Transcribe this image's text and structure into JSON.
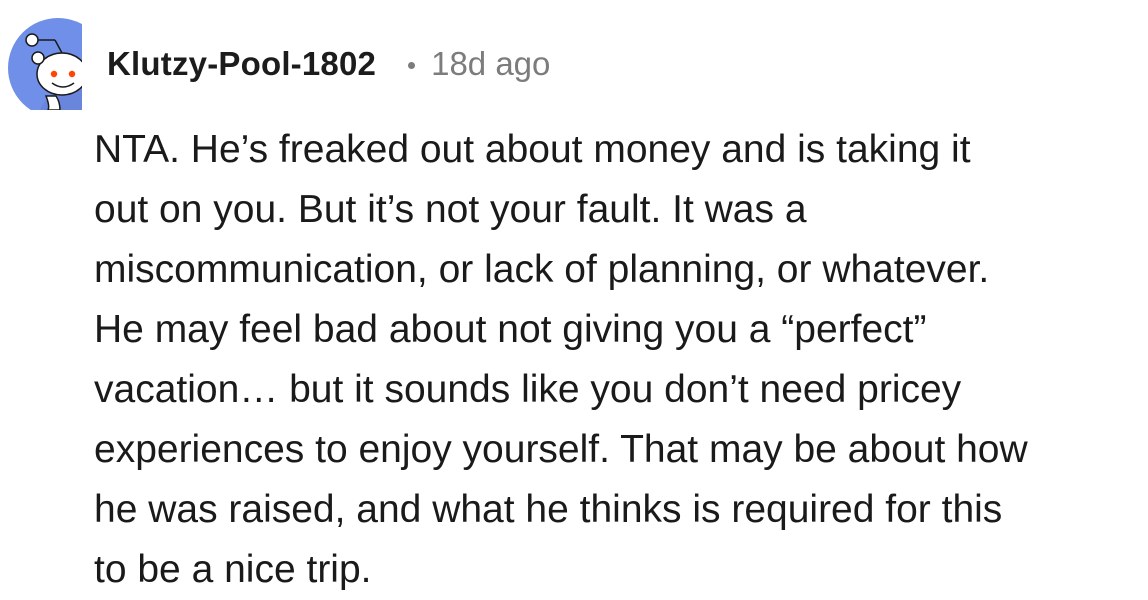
{
  "comment": {
    "avatar_icon": "snoo-avatar-icon",
    "avatar_bg_color": "#7193ff",
    "username": "Klutzy-Pool-1802",
    "separator": "•",
    "timestamp": "18d ago",
    "body_lines": [
      "NTA. He’s freaked out about money and is taking it",
      "out on you. But it’s not your fault. It was a",
      "miscommunication, or lack of planning, or whatever.",
      "He may feel bad about not giving you a “perfect”",
      "vacation… but it sounds like you don’t need pricey",
      "experiences to enjoy yourself. That may be about how",
      "he was raised, and what he thinks is required for this",
      "to be a nice trip."
    ]
  }
}
